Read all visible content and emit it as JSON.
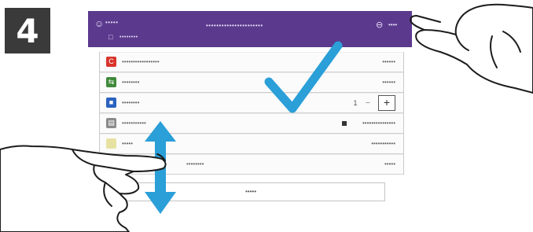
{
  "step": {
    "number": "4"
  },
  "header": {
    "user_icon": "person-icon",
    "user_name": "•••••",
    "title": "••••••••••••••••••••••",
    "subtitle": "••••••••",
    "logout_icon": "logout-icon",
    "logout_label": "••••",
    "color": "#5b3a8e"
  },
  "apps": [
    {
      "name": "•••••••••••••••••",
      "value": "••••••",
      "icon_color": "#d9342b",
      "icon_glyph": "C"
    },
    {
      "name": "••••••••",
      "value": "••••••",
      "icon_color": "#3f8a3a",
      "icon_glyph": "⇆"
    },
    {
      "name": "••••••••",
      "stepper": {
        "count": "1",
        "minus": "−",
        "plus": "+"
      },
      "icon_color": "#2a63c0",
      "icon_glyph": "■"
    },
    {
      "name": "•••••••••••",
      "value": "•••••••••••••••",
      "icon_color": "#8a8a8a",
      "icon_glyph": "▤"
    },
    {
      "name": "•••••",
      "value": "•••••••••••",
      "icon_color": "#e8e2a2",
      "icon_glyph": ""
    },
    {
      "name": "••••••••",
      "value": "•••••",
      "icon_color": "#ffffff",
      "icon_glyph": ""
    }
  ],
  "close_button_label": "•••••",
  "gestures": {
    "hand_tap": "tap-hand-icon",
    "hand_swipe": "swipe-hand-icon",
    "check": "checkmark-icon",
    "scroll": "up-down-arrow-icon"
  },
  "accent": "#2a9fd8"
}
